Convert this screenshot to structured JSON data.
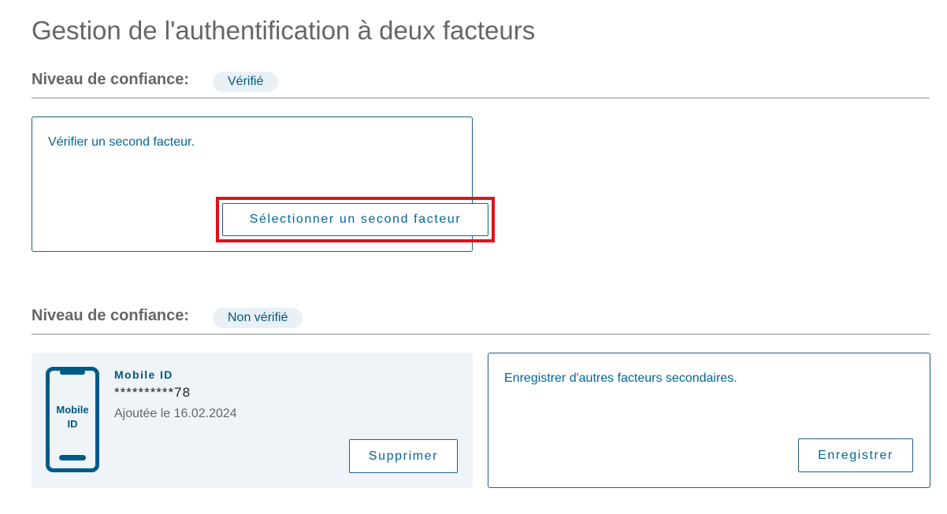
{
  "page": {
    "title": "Gestion de l'authentification à deux facteurs"
  },
  "levels": [
    {
      "label": "Niveau de confiance:",
      "badge": "Vérifié",
      "card": {
        "text": "Vérifier un second facteur.",
        "button_label": "Sélectionner un second facteur"
      }
    },
    {
      "label": "Niveau de confiance:",
      "badge": "Non vérifié",
      "factor": {
        "icon": "mobile-phone-icon",
        "icon_label_line1": "Mobile",
        "icon_label_line2": "ID",
        "name": "Mobile ID",
        "masked_number": "**********78",
        "added": "Ajoutée le 16.02.2024",
        "delete_label": "Supprimer"
      },
      "register_card": {
        "text": "Enregistrer d'autres facteurs secondaires.",
        "button_label": "Enregistrer"
      }
    }
  ],
  "colors": {
    "accent": "#006699",
    "border": "#1f5f86",
    "badge_bg": "#e9f1f7",
    "factor_card_bg": "#eef4f8",
    "highlight": "#e0111c",
    "heading_gray": "#666666"
  }
}
